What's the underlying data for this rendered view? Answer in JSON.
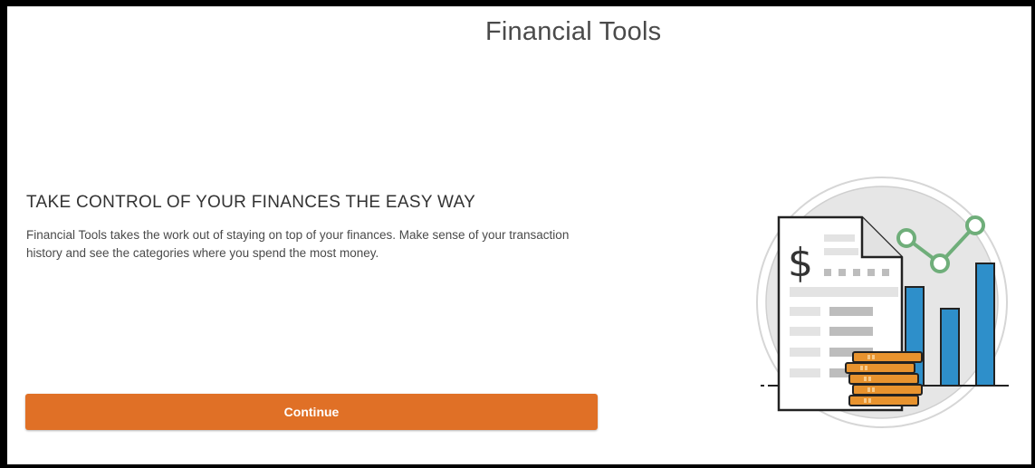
{
  "page": {
    "title": "Financial Tools"
  },
  "intro": {
    "headline": "TAKE CONTROL OF YOUR FINANCES THE EASY WAY",
    "description": "Financial Tools takes the work out of staying on top of your finances. Make sense of your transaction history and see the categories where you spend the most money."
  },
  "actions": {
    "continue_label": "Continue"
  },
  "illustration": {
    "currency_symbol": "$",
    "name": "financial-report-illustration"
  },
  "colors": {
    "accent": "#e07026",
    "bar": "#2e8fca",
    "trend": "#6fae7a",
    "coin": "#e8932e"
  }
}
